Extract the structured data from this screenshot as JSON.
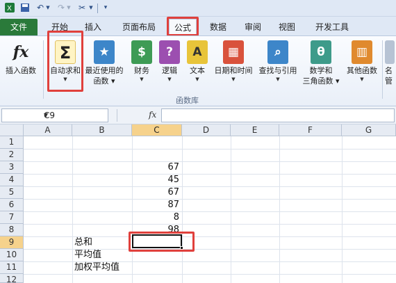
{
  "ribbon_tabs": [
    {
      "label": "文件"
    },
    {
      "label": "开始"
    },
    {
      "label": "插入"
    },
    {
      "label": "页面布局"
    },
    {
      "label": "公式"
    },
    {
      "label": "数据"
    },
    {
      "label": "审阅"
    },
    {
      "label": "视图"
    },
    {
      "label": "开发工具"
    }
  ],
  "ribbon": {
    "insert_function": {
      "icon_text": "fx",
      "label": "插入函数"
    },
    "autosum": {
      "icon_text": "Σ",
      "label": "自动求和"
    },
    "recent": {
      "label_1": "最近使用的",
      "label_2": "函数"
    },
    "financial": {
      "label": "财务"
    },
    "logical": {
      "icon_text": "?",
      "label": "逻辑"
    },
    "text": {
      "icon_text": "A",
      "label": "文本"
    },
    "datetime": {
      "label": "日期和时间"
    },
    "lookup": {
      "label": "查找与引用"
    },
    "mathtrig": {
      "icon_text": "θ",
      "label_1": "数学和",
      "label_2": "三角函数"
    },
    "more": {
      "label": "其他函数"
    },
    "name_manager_partial": {
      "label_1": "名",
      "label_2": "管"
    },
    "group_label": "函数库"
  },
  "formula_bar": {
    "name_box": "C9",
    "fx": "fx",
    "value": ""
  },
  "grid": {
    "columns": [
      "A",
      "B",
      "C",
      "D",
      "E",
      "F",
      "G"
    ],
    "rows": [
      "1",
      "2",
      "3",
      "4",
      "5",
      "6",
      "7",
      "8",
      "9",
      "10",
      "11",
      "12"
    ],
    "c_values": [
      "67",
      "45",
      "67",
      "87",
      "8",
      "98"
    ],
    "b_labels": [
      "总和",
      "平均值",
      "加权平均值"
    ],
    "active_cell": "C9"
  },
  "colors": {
    "highlight": "#e0403c",
    "file_tab": "#2a7a3a",
    "selected_header": "#f6d28c"
  }
}
